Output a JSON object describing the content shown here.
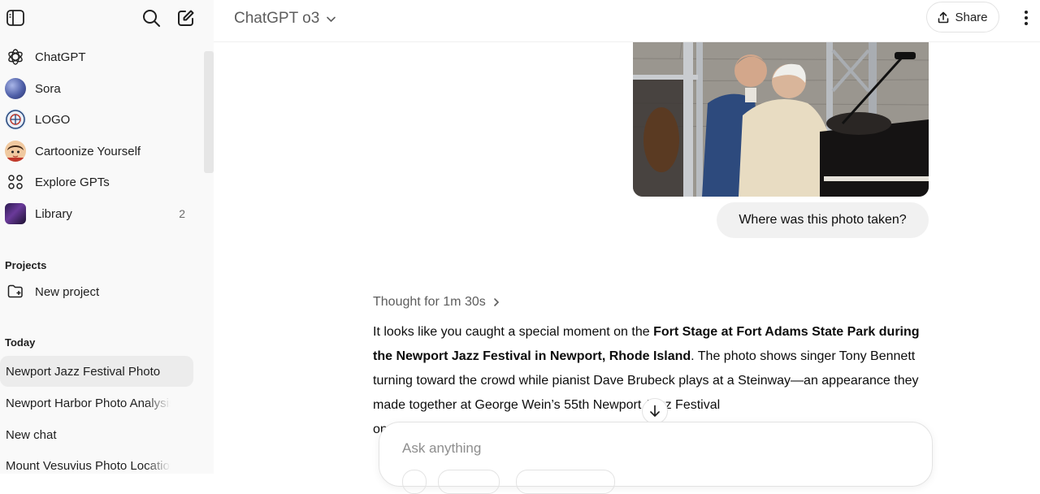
{
  "sidebar": {
    "nav": [
      {
        "label": "ChatGPT",
        "icon": "openai-logo-icon"
      },
      {
        "label": "Sora",
        "icon": "sora-avatar-icon"
      },
      {
        "label": "LOGO",
        "icon": "logo-gpt-avatar-icon"
      },
      {
        "label": "Cartoonize Yourself",
        "icon": "cartoon-avatar-icon"
      },
      {
        "label": "Explore GPTs",
        "icon": "grid-icon"
      },
      {
        "label": "Library",
        "icon": "library-thumbnail-icon",
        "count": "2"
      }
    ],
    "projects_heading": "Projects",
    "new_project": "New project",
    "today_heading": "Today",
    "chats": [
      {
        "label": "Newport Jazz Festival Photo",
        "active": true
      },
      {
        "label": "Newport Harbor Photo Analysis"
      },
      {
        "label": "New chat"
      },
      {
        "label": "Mount Vesuvius Photo Location"
      }
    ]
  },
  "header": {
    "model": "ChatGPT o3",
    "share_label": "Share"
  },
  "conversation": {
    "user_message": "Where was this photo taken?",
    "thought_label": "Thought for 1m 30s",
    "response": {
      "p1": "It looks like you caught a special moment on the ",
      "bold1": "Fort Stage at Fort Adams State Park during the Newport Jazz Festival in Newport, Rhode Island",
      "p2": ". The photo shows singer Tony Bennett turning toward the crowd while pianist Dave Brubeck plays at a Steinway—an appearance they made together at George Wein’s 55th Newport Jazz Festival",
      "p3": "on"
    }
  },
  "composer": {
    "placeholder": "Ask anything"
  },
  "colors": {
    "sidebar_bg": "#f9f9f9",
    "active_chat_bg": "#ececec",
    "bubble_bg": "#f1f1f1"
  }
}
